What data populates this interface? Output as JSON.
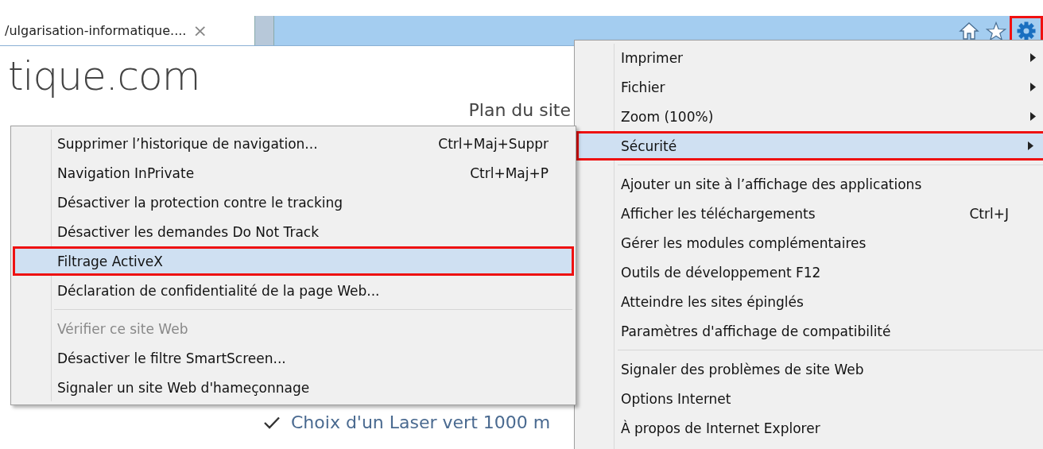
{
  "tab_bar": {
    "tabs": [
      {
        "title": "/ulgarisation-informatique....",
        "selected": true,
        "close": "×"
      },
      {
        "selected": false
      }
    ],
    "buttons": [
      {
        "kind": "home",
        "outlined": false
      },
      {
        "kind": "star",
        "outlined": false
      },
      {
        "kind": "gear",
        "outlined": true
      }
    ]
  },
  "page": {
    "site_title": "tique.com",
    "nav_link": "Plan du site",
    "list": [
      "Choix d'un Laser vert 1000 m"
    ]
  },
  "tools_menu": {
    "groups": [
      [
        {
          "label": "Imprimer",
          "has_submenu": true,
          "selected": false,
          "outlined": false
        },
        {
          "label": "Fichier",
          "has_submenu": true,
          "selected": false,
          "outlined": false
        },
        {
          "label": "Zoom (100%)",
          "has_submenu": true,
          "selected": false,
          "outlined": false
        },
        {
          "label": "Sécurité",
          "has_submenu": true,
          "selected": true,
          "outlined": true
        }
      ],
      [
        {
          "label": "Ajouter un site à l’affichage des applications",
          "selected": false,
          "outlined": false
        },
        {
          "label": "Afficher les téléchargements",
          "shortcut": "Ctrl+J",
          "selected": false,
          "outlined": false
        },
        {
          "label": "Gérer les modules complémentaires",
          "selected": false,
          "outlined": false
        },
        {
          "label": "Outils de développement F12",
          "selected": false,
          "outlined": false
        },
        {
          "label": "Atteindre les sites épinglés",
          "selected": false,
          "outlined": false
        },
        {
          "label": "Paramètres d'affichage de compatibilité",
          "selected": false,
          "outlined": false
        }
      ],
      [
        {
          "label": "Signaler des problèmes de site Web",
          "selected": false,
          "outlined": false
        },
        {
          "label": "Options Internet",
          "selected": false,
          "outlined": false
        },
        {
          "label": "À propos de Internet Explorer",
          "selected": false,
          "outlined": false
        }
      ]
    ]
  },
  "security_submenu": {
    "groups": [
      [
        {
          "label": "Supprimer l’historique de navigation...",
          "shortcut": "Ctrl+Maj+Suppr",
          "selected": false,
          "outlined": false,
          "disabled": false
        },
        {
          "label": "Navigation InPrivate",
          "shortcut": "Ctrl+Maj+P",
          "selected": false,
          "outlined": false,
          "disabled": false
        },
        {
          "label": "Désactiver la protection contre le tracking",
          "selected": false,
          "outlined": false,
          "disabled": false
        },
        {
          "label": "Désactiver les demandes Do Not Track",
          "selected": false,
          "outlined": false,
          "disabled": false
        },
        {
          "label": "Filtrage ActiveX",
          "selected": true,
          "outlined": true,
          "disabled": false
        },
        {
          "label": "Déclaration de confidentialité de la page Web...",
          "selected": false,
          "outlined": false,
          "disabled": false
        }
      ],
      [
        {
          "label": "Vérifier ce site Web",
          "selected": false,
          "outlined": false,
          "disabled": true
        },
        {
          "label": "Désactiver le filtre SmartScreen...",
          "selected": false,
          "outlined": false,
          "disabled": false
        },
        {
          "label": "Signaler un site Web d'hameçonnage",
          "selected": false,
          "outlined": false,
          "disabled": false
        }
      ]
    ]
  }
}
